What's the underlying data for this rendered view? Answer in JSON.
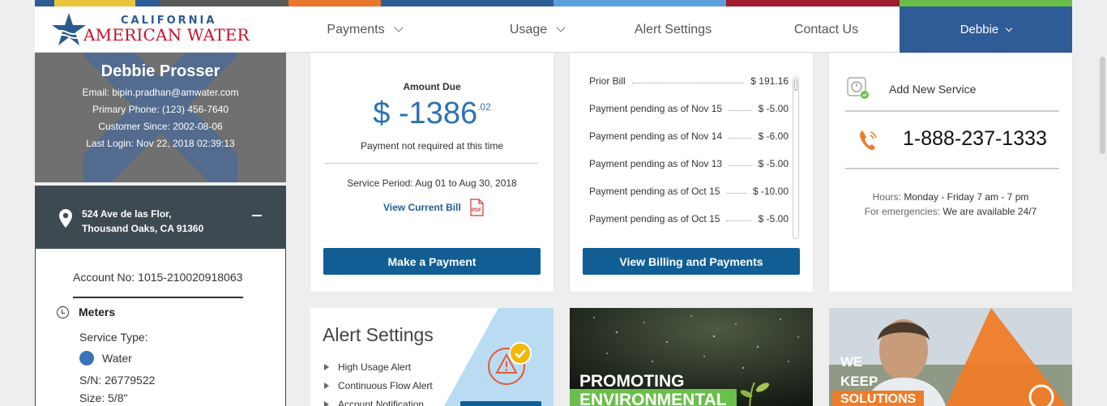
{
  "header": {
    "topbar_colors": [
      "#2f5b96",
      "#e8a020",
      "#606060",
      "#e8762d",
      "#2f5b96",
      "#5aa0dc",
      "#9e1b32",
      "#6abf4b"
    ],
    "logo": {
      "line1": "CALIFORNIA",
      "line2": "AMERICAN WATER"
    },
    "nav": [
      {
        "label": "Payments"
      },
      {
        "label": "Usage"
      },
      {
        "label": "Alert Settings"
      },
      {
        "label": "Contact Us"
      }
    ],
    "user_menu": "Debbie"
  },
  "profile": {
    "name": "Debbie Prosser",
    "email": "Email: bipin.pradhan@amwater.com",
    "phone": "Primary Phone: (123) 456-7640",
    "since": "Customer Since: 2002-08-06",
    "last_login": "Last Login: Nov 22, 2018 02:39:13"
  },
  "address": {
    "line1": "524 Ave de las Flor,",
    "line2": "Thousand Oaks, CA 91360"
  },
  "account": {
    "number": "Account No: 1015-210020918063",
    "meters_label": "Meters",
    "service_type": "Service Type:",
    "water": "Water",
    "serial": "S/N: 26779522",
    "size": "Size: 5/8\""
  },
  "bill_card": {
    "label": "Amount Due",
    "amount_main": "$ -1386",
    "amount_cents": ".02",
    "note": "Payment not required at this time",
    "period": "Service Period: Aug 01 to Aug 30, 2018",
    "view_bill": "View Current Bill",
    "button": "Make a Payment"
  },
  "billing_card": {
    "rows": [
      {
        "desc": "Prior Bill",
        "amount": "$ 191.16"
      },
      {
        "desc": "Payment pending as of Nov 15",
        "amount": "$ -5.00"
      },
      {
        "desc": "Payment pending as of Nov 14",
        "amount": "$ -6.00"
      },
      {
        "desc": "Payment pending as of Nov 13",
        "amount": "$ -5.00"
      },
      {
        "desc": "Payment pending as of Oct 15",
        "amount": "$ -10.00"
      },
      {
        "desc": "Payment pending as of Oct 15",
        "amount": "$ -5.00"
      }
    ],
    "button": "View Billing and Payments"
  },
  "service_card": {
    "add_service": "Add New Service",
    "phone": "1-888-237-1333",
    "hours_label": "Hours:",
    "hours_value": "Monday - Friday 7 am - 7 pm",
    "emergency_label": "For emergencies:",
    "emergency_value": "We are available 24/7"
  },
  "alert_tile": {
    "title": "Alert Settings",
    "items": [
      "High Usage Alert",
      "Continuous Flow Alert",
      "Account Notification"
    ]
  },
  "env_tile": {
    "line1": "PROMOTING",
    "line2": "ENVIRONMENTAL"
  },
  "solutions_tile": {
    "line1": "WE",
    "line2": "KEEP",
    "line3": "SOLUTIONS"
  }
}
